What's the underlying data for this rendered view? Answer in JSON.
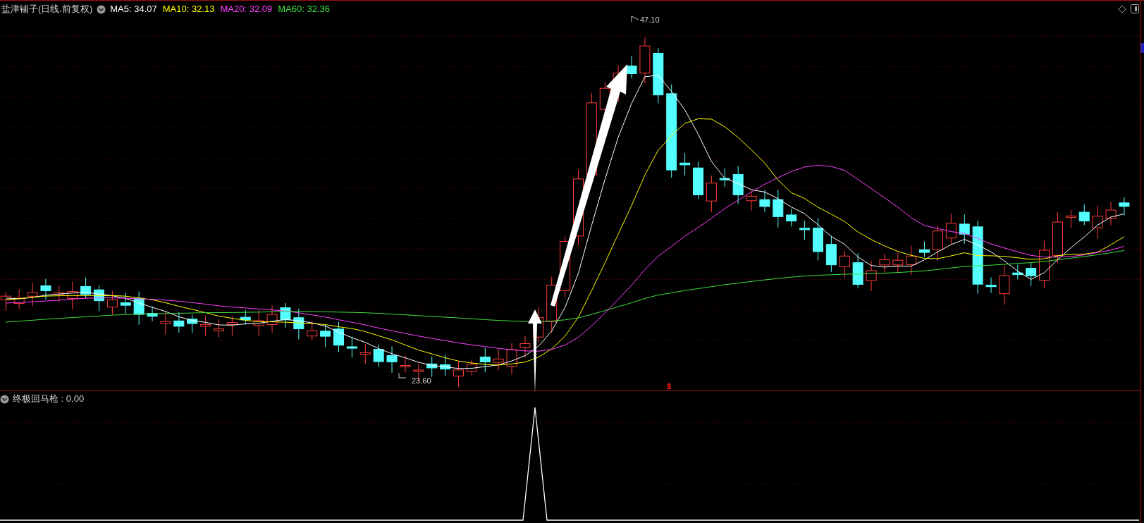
{
  "header": {
    "title": "盐津铺子(日线.前复权)",
    "ma_values": [
      {
        "label": "MA5: 34.07",
        "color": "#ffffff"
      },
      {
        "label": "MA10: 32.13",
        "color": "#ffff00"
      },
      {
        "label": "MA20: 32.09",
        "color": "#ff40ff"
      },
      {
        "label": "MA60: 32.36",
        "color": "#40e040"
      }
    ]
  },
  "price_labels": {
    "high": "47.10",
    "low": "23.60"
  },
  "signal_marker": "$",
  "indicator": {
    "title": "终极回马枪",
    "value": ": 0.00"
  }
}
